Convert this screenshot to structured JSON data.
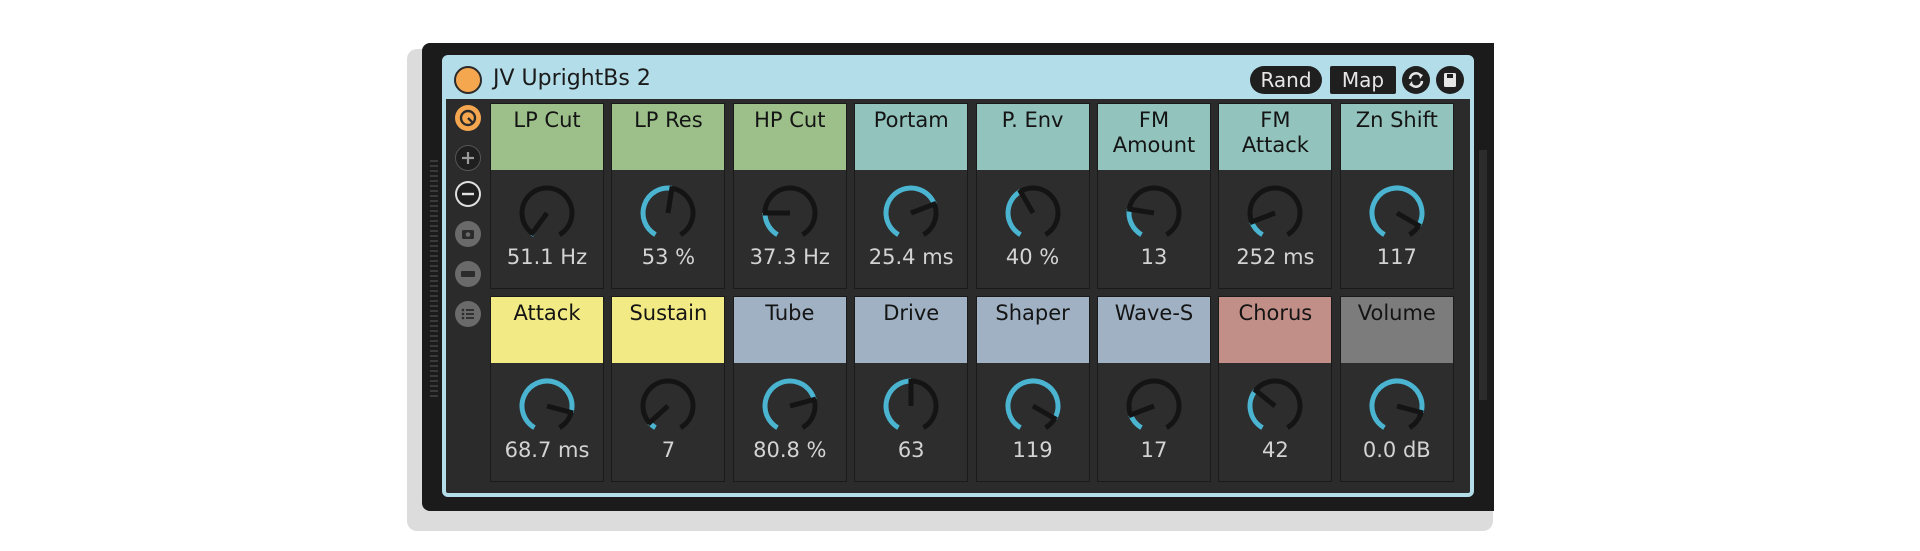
{
  "device": {
    "title": "JV UprightBs 2",
    "power_color": "#f5a750",
    "header_color": "#b3dde8",
    "buttons": {
      "rand_label": "Rand",
      "map_label": "Map"
    },
    "header_icons": [
      "randomize-icon",
      "save-icon"
    ]
  },
  "sidebar": {
    "items": [
      {
        "icon": "macro-mapping-icon",
        "color": "#f5a750"
      },
      {
        "icon": "add-icon"
      },
      {
        "icon": "remove-icon"
      },
      {
        "icon": "snapshot-icon"
      },
      {
        "icon": "variation-icon"
      },
      {
        "icon": "list-icon"
      }
    ]
  },
  "knobs": {
    "rows": [
      [
        {
          "label": "LP Cut",
          "value": "51.1 Hz",
          "color": "#9dc08b",
          "fraction": 0.02
        },
        {
          "label": "LP Res",
          "value": "53 %",
          "color": "#9dc08b",
          "fraction": 0.53
        },
        {
          "label": "HP Cut",
          "value": "37.3 Hz",
          "color": "#9dc08b",
          "fraction": 0.2
        },
        {
          "label": "Portam",
          "value": "25.4 ms",
          "color": "#93c3bd",
          "fraction": 0.73
        },
        {
          "label": "P. Env",
          "value": "40 %",
          "color": "#93c3bd",
          "fraction": 0.4
        },
        {
          "label": "FM\nAmount",
          "value": "13",
          "color": "#93c3bd",
          "fraction": 0.23
        },
        {
          "label": "FM\nAttack",
          "value": "252 ms",
          "color": "#93c3bd",
          "fraction": 0.13
        },
        {
          "label": "Zn Shift",
          "value": "117",
          "color": "#93c3bd",
          "fraction": 0.9
        }
      ],
      [
        {
          "label": "Attack",
          "value": "68.7 ms",
          "color": "#f2eb85",
          "fraction": 0.85
        },
        {
          "label": "Sustain",
          "value": "7",
          "color": "#f2eb85",
          "fraction": 0.06
        },
        {
          "label": "Tube",
          "value": "80.8 %",
          "color": "#a0b1c3",
          "fraction": 0.75
        },
        {
          "label": "Drive",
          "value": "63",
          "color": "#a0b1c3",
          "fraction": 0.5
        },
        {
          "label": "Shaper",
          "value": "119",
          "color": "#a0b1c3",
          "fraction": 0.9
        },
        {
          "label": "Wave-S",
          "value": "17",
          "color": "#a0b1c3",
          "fraction": 0.13
        },
        {
          "label": "Chorus",
          "value": "42",
          "color": "#c18f88",
          "fraction": 0.33
        },
        {
          "label": "Volume",
          "value": "0.0 dB",
          "color": "#7c7c7c",
          "fraction": 0.85
        }
      ]
    ]
  },
  "colors": {
    "accent": "#4bb4d0",
    "knob_ring": "#141414",
    "panel": "#2b2b2b",
    "value_text": "#d3d3d3"
  }
}
